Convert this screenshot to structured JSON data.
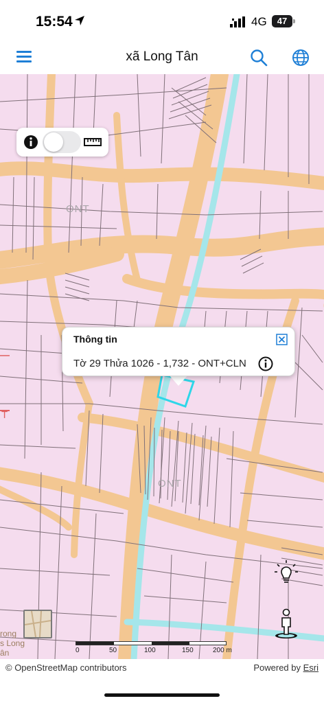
{
  "status_bar": {
    "time": "15:54",
    "network": "4G",
    "battery": "47"
  },
  "header": {
    "title": "xã Long Tân",
    "menu_icon": "hamburger-menu-icon",
    "search_icon": "search-icon",
    "globe_icon": "globe-icon",
    "accent_color": "#1e7fd6"
  },
  "map": {
    "labels": [
      "ONT",
      "ONT",
      "T"
    ],
    "thumbnail_text": [
      "rong",
      "s Long",
      "ân"
    ],
    "colors": {
      "background": "#f5dcee",
      "road": "#f3c792",
      "canal": "#a5e6ea",
      "parcel_line": "#7f6f78",
      "selected_parcel": "#2ed6e8"
    }
  },
  "toggle_panel": {
    "info_icon": "info-icon",
    "ruler_icon": "ruler-icon",
    "toggle_on": false
  },
  "popup": {
    "title": "Thông tin",
    "body": "Tờ 29 Thửa 1026 - 1,732 - ONT+CLN",
    "close_icon": "close-box-icon",
    "info_icon": "info-icon"
  },
  "controls": {
    "bulb_icon": "lightbulb-icon",
    "person_icon": "street-view-person-icon"
  },
  "scalebar": {
    "labels": [
      "0",
      "50",
      "100",
      "150",
      "200 m"
    ]
  },
  "attribution": {
    "left": "© OpenStreetMap contributors",
    "right_prefix": "Powered by ",
    "right_link": "Esri"
  }
}
